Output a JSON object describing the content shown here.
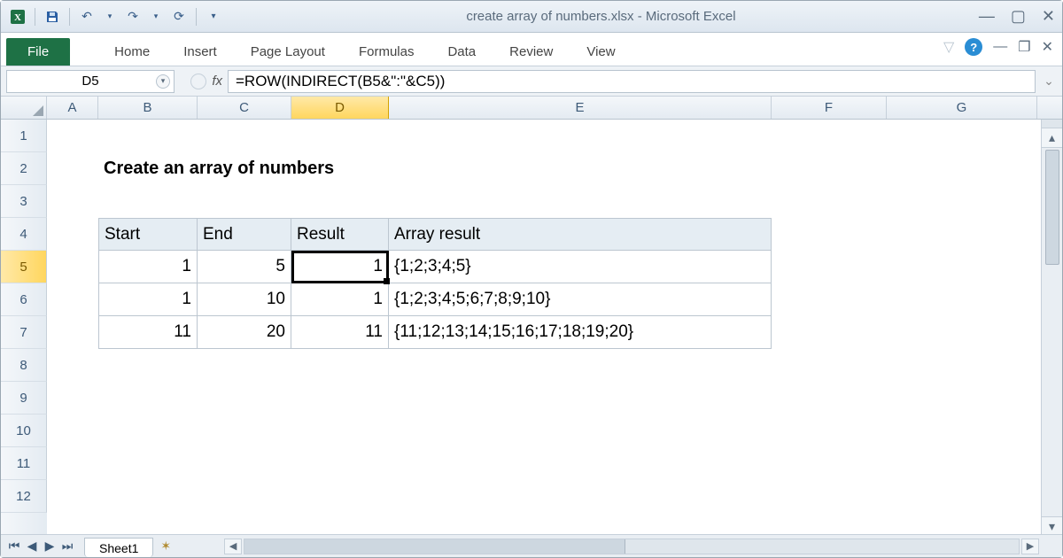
{
  "title": "create array of numbers.xlsx  -  Microsoft Excel",
  "ribbon": {
    "file": "File",
    "tabs": [
      "Home",
      "Insert",
      "Page Layout",
      "Formulas",
      "Data",
      "Review",
      "View"
    ]
  },
  "namebox": "D5",
  "fx_label": "fx",
  "formula": "=ROW(INDIRECT(B5&\":\"&C5))",
  "columns": [
    "A",
    "B",
    "C",
    "D",
    "E",
    "F",
    "G"
  ],
  "selected_col": "D",
  "rows": [
    "1",
    "2",
    "3",
    "4",
    "5",
    "6",
    "7",
    "8",
    "9",
    "10",
    "11",
    "12"
  ],
  "selected_row": "5",
  "content": {
    "heading": "Create an array of numbers",
    "headers": {
      "b": "Start",
      "c": "End",
      "d": "Result",
      "e": "Array result"
    },
    "r5": {
      "b": "1",
      "c": "5",
      "d": "1",
      "e": "{1;2;3;4;5}"
    },
    "r6": {
      "b": "1",
      "c": "10",
      "d": "1",
      "e": "{1;2;3;4;5;6;7;8;9;10}"
    },
    "r7": {
      "b": "11",
      "c": "20",
      "d": "11",
      "e": "{11;12;13;14;15;16;17;18;19;20}"
    }
  },
  "sheet": {
    "name": "Sheet1"
  }
}
